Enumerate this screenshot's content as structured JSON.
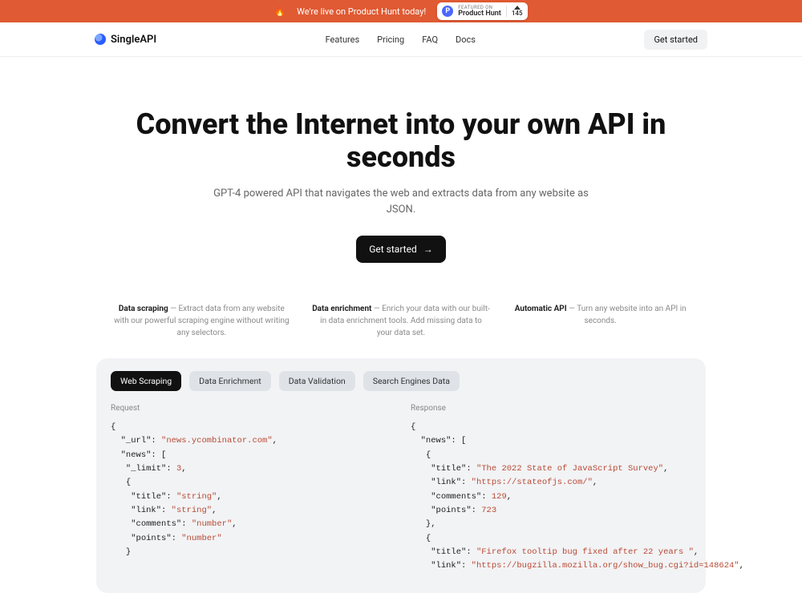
{
  "banner": {
    "text": "We're live on Product Hunt today!",
    "badge": {
      "featured": "FEATURED ON",
      "site": "Product Hunt",
      "votes": "145"
    }
  },
  "nav": {
    "brand": "SingleAPI",
    "links": [
      "Features",
      "Pricing",
      "FAQ",
      "Docs"
    ],
    "cta": "Get started"
  },
  "hero": {
    "title": "Convert the Internet into your own API in seconds",
    "subtitle": "GPT-4 powered API that navigates the web and extracts data from any website as JSON.",
    "cta": "Get started"
  },
  "features": [
    {
      "title": "Data scraping",
      "body": "Extract data from any website with our powerful scraping engine without writing any selectors."
    },
    {
      "title": "Data enrichment",
      "body": "Enrich your data with our built-in data enrichment tools. Add missing data to your data set."
    },
    {
      "title": "Automatic API",
      "body": "Turn any website into an API in seconds."
    }
  ],
  "panel": {
    "tabs": [
      "Web Scraping",
      "Data Enrichment",
      "Data Validation",
      "Search Engines Data"
    ],
    "active_tab": 0,
    "request_label": "Request",
    "response_label": "Response",
    "request": {
      "_url": "news.ycombinator.com",
      "_limit": 3,
      "schema": {
        "news": [
          {
            "title": "string",
            "link": "string",
            "comments": "number",
            "points": "number"
          }
        ]
      }
    },
    "response": {
      "news": [
        {
          "title": "The 2022 State of JavaScript Survey",
          "link": "https://stateofjs.com/",
          "comments": 129,
          "points": 723
        },
        {
          "title": "Firefox tooltip bug fixed after 22 years ",
          "link": "https://bugzilla.mozilla.org/show_bug.cgi?id=148624"
        }
      ]
    }
  }
}
